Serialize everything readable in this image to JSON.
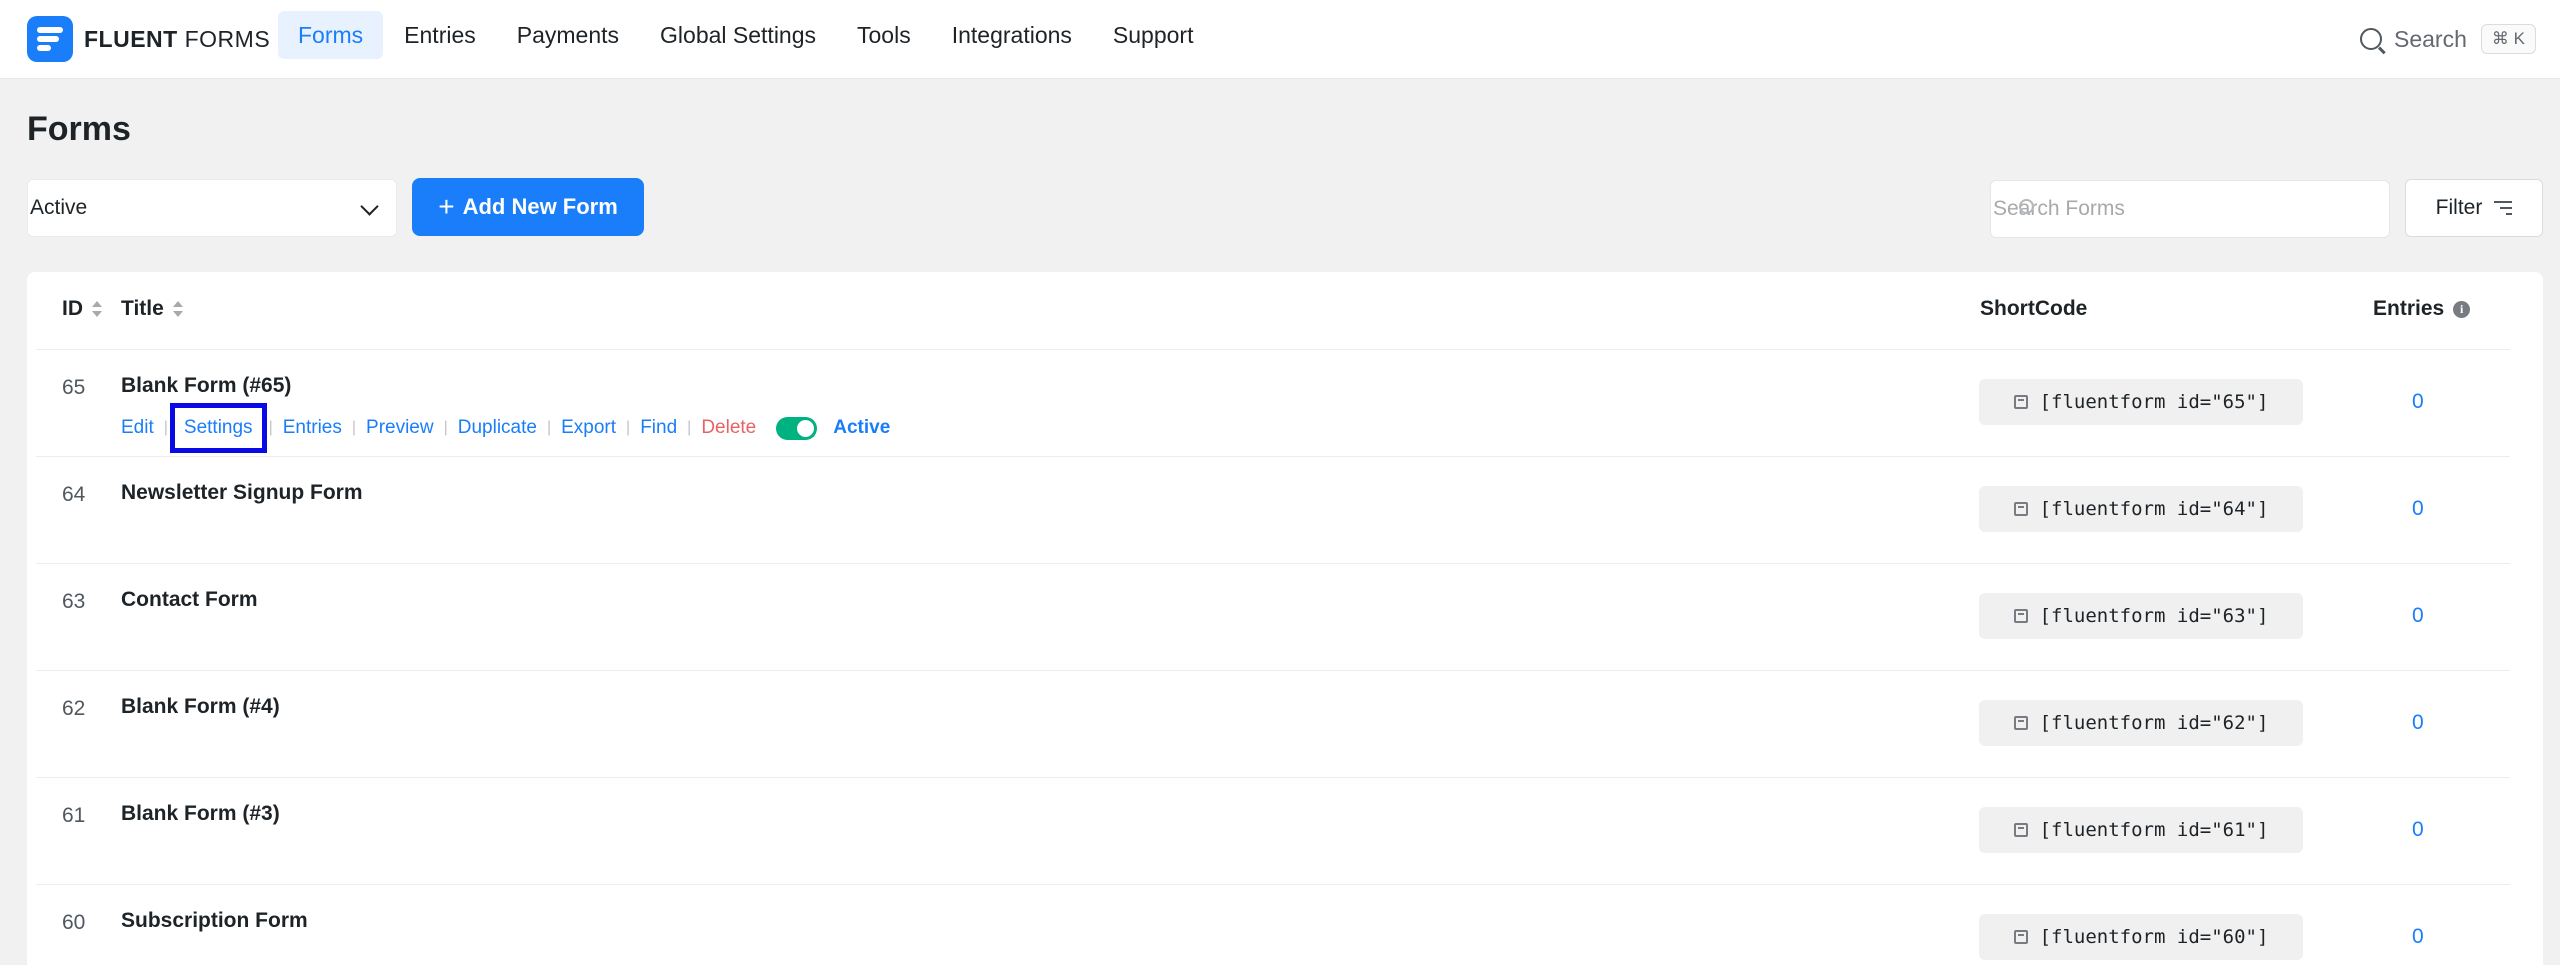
{
  "app": {
    "logo_bold": "FLUENT",
    "logo_light": "FORMS"
  },
  "nav": {
    "items": [
      "Forms",
      "Entries",
      "Payments",
      "Global Settings",
      "Tools",
      "Integrations",
      "Support"
    ],
    "active": "Forms"
  },
  "global_search": {
    "label": "Search",
    "shortcut": "⌘ K"
  },
  "page": {
    "title": "Forms"
  },
  "toolbar": {
    "status_select_value": "Active",
    "add_button_label": "Add New Form",
    "search_placeholder": "Search Forms",
    "filter_label": "Filter"
  },
  "table": {
    "headers": {
      "id": "ID",
      "title": "Title",
      "shortcode": "ShortCode",
      "entries": "Entries"
    },
    "row_actions": {
      "edit": "Edit",
      "settings": "Settings",
      "entries": "Entries",
      "preview": "Preview",
      "duplicate": "Duplicate",
      "export": "Export",
      "find": "Find",
      "delete": "Delete",
      "status_label": "Active"
    },
    "rows": [
      {
        "id": "65",
        "title": "Blank Form (#65)",
        "shortcode": "[fluentform id=\"65\"]",
        "entries": "0"
      },
      {
        "id": "64",
        "title": "Newsletter Signup Form",
        "shortcode": "[fluentform id=\"64\"]",
        "entries": "0"
      },
      {
        "id": "63",
        "title": "Contact Form",
        "shortcode": "[fluentform id=\"63\"]",
        "entries": "0"
      },
      {
        "id": "62",
        "title": "Blank Form (#4)",
        "shortcode": "[fluentform id=\"62\"]",
        "entries": "0"
      },
      {
        "id": "61",
        "title": "Blank Form (#3)",
        "shortcode": "[fluentform id=\"61\"]",
        "entries": "0"
      },
      {
        "id": "60",
        "title": "Subscription Form",
        "shortcode": "[fluentform id=\"60\"]",
        "entries": "0"
      }
    ]
  },
  "colors": {
    "primary": "#1a7efb",
    "danger": "#e76363",
    "toggle_on": "#00b27f",
    "highlight_box": "#0a0ae6"
  }
}
